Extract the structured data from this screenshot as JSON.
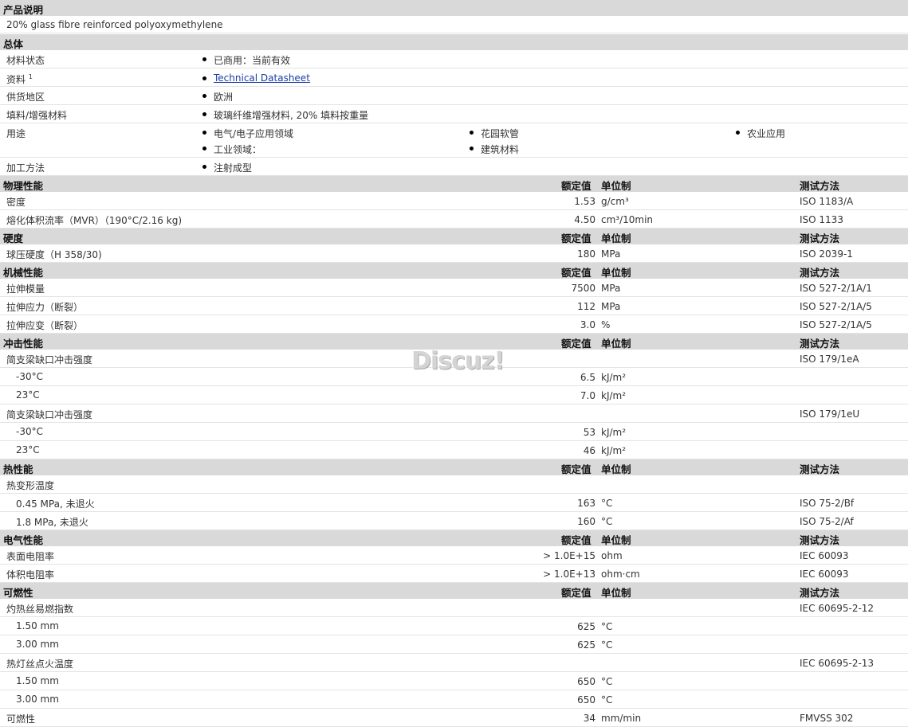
{
  "headers": {
    "value": "额定值",
    "unit": "单位制",
    "method": "测试方法"
  },
  "product": {
    "title": "产品说明",
    "desc": "20% glass fibre reinforced polyoxymethylene"
  },
  "general": {
    "title": "总体",
    "status_label": "材料状态",
    "status_value": "已商用：当前有效",
    "docs_label": "资料",
    "docs_sup": "1",
    "docs_link": "Technical Datasheet",
    "supply_label": "供货地区",
    "supply_value": "欧洲",
    "filler_label": "填料/增强材料",
    "filler_value": "玻璃纤维增强材料, 20% 填料按重量",
    "uses_label": "用途",
    "uses": [
      "电气/电子应用领域",
      "工业领域：",
      "花园软管",
      "建筑材料",
      "农业应用"
    ],
    "proc_label": "加工方法",
    "proc_value": "注射成型"
  },
  "physical": {
    "title": "物理性能",
    "rows": [
      {
        "label": "密度",
        "value": "1.53",
        "unit": "g/cm³",
        "method": "ISO 1183/A"
      },
      {
        "label": "熔化体积流率（MVR）（190°C/2.16 kg)",
        "value": "4.50",
        "unit": "cm³/10min",
        "method": "ISO 1133"
      }
    ]
  },
  "hardness": {
    "title": "硬度",
    "rows": [
      {
        "label": "球压硬度（H 358/30)",
        "value": "180",
        "unit": "MPa",
        "method": "ISO 2039-1"
      }
    ]
  },
  "mechanical": {
    "title": "机械性能",
    "rows": [
      {
        "label": "拉伸模量",
        "value": "7500",
        "unit": "MPa",
        "method": "ISO 527-2/1A/1"
      },
      {
        "label": "拉伸应力（断裂）",
        "value": "112",
        "unit": "MPa",
        "method": "ISO 527-2/1A/5"
      },
      {
        "label": "拉伸应变（断裂）",
        "value": "3.0",
        "unit": "%",
        "method": "ISO 527-2/1A/5"
      }
    ]
  },
  "impact": {
    "title": "冲击性能",
    "rows": [
      {
        "label": "简支梁缺口冲击强度",
        "value": "",
        "unit": "",
        "method": "ISO 179/1eA"
      },
      {
        "label": "-30°C",
        "value": "6.5",
        "unit": "kJ/m²",
        "method": ""
      },
      {
        "label": "23°C",
        "value": "7.0",
        "unit": "kJ/m²",
        "method": ""
      },
      {
        "label": "简支梁缺口冲击强度",
        "value": "",
        "unit": "",
        "method": "ISO 179/1eU"
      },
      {
        "label": "-30°C",
        "value": "53",
        "unit": "kJ/m²",
        "method": ""
      },
      {
        "label": "23°C",
        "value": "46",
        "unit": "kJ/m²",
        "method": ""
      }
    ]
  },
  "thermal": {
    "title": "热性能",
    "rows": [
      {
        "label": "热变形温度",
        "value": "",
        "unit": "",
        "method": ""
      },
      {
        "label": "0.45 MPa, 未退火",
        "value": "163",
        "unit": "°C",
        "method": "ISO 75-2/Bf"
      },
      {
        "label": "1.8 MPa, 未退火",
        "value": "160",
        "unit": "°C",
        "method": "ISO 75-2/Af"
      }
    ]
  },
  "electrical": {
    "title": "电气性能",
    "rows": [
      {
        "label": "表面电阻率",
        "value": "> 1.0E+15",
        "unit": "ohm",
        "method": "IEC 60093"
      },
      {
        "label": "体积电阻率",
        "value": "> 1.0E+13",
        "unit": "ohm·cm",
        "method": "IEC 60093"
      }
    ]
  },
  "flammability": {
    "title": "可燃性",
    "rows": [
      {
        "label": "灼热丝易燃指数",
        "value": "",
        "unit": "",
        "method": "IEC 60695-2-12"
      },
      {
        "label": "1.50 mm",
        "value": "625",
        "unit": "°C",
        "method": ""
      },
      {
        "label": "3.00 mm",
        "value": "625",
        "unit": "°C",
        "method": ""
      },
      {
        "label": "热灯丝点火温度",
        "value": "",
        "unit": "",
        "method": "IEC 60695-2-13"
      },
      {
        "label": "1.50 mm",
        "value": "650",
        "unit": "°C",
        "method": ""
      },
      {
        "label": "3.00 mm",
        "value": "650",
        "unit": "°C",
        "method": ""
      },
      {
        "label": "可燃性",
        "value": "34",
        "unit": "mm/min",
        "method": "FMVSS 302"
      }
    ]
  },
  "watermark": "Discuz!"
}
